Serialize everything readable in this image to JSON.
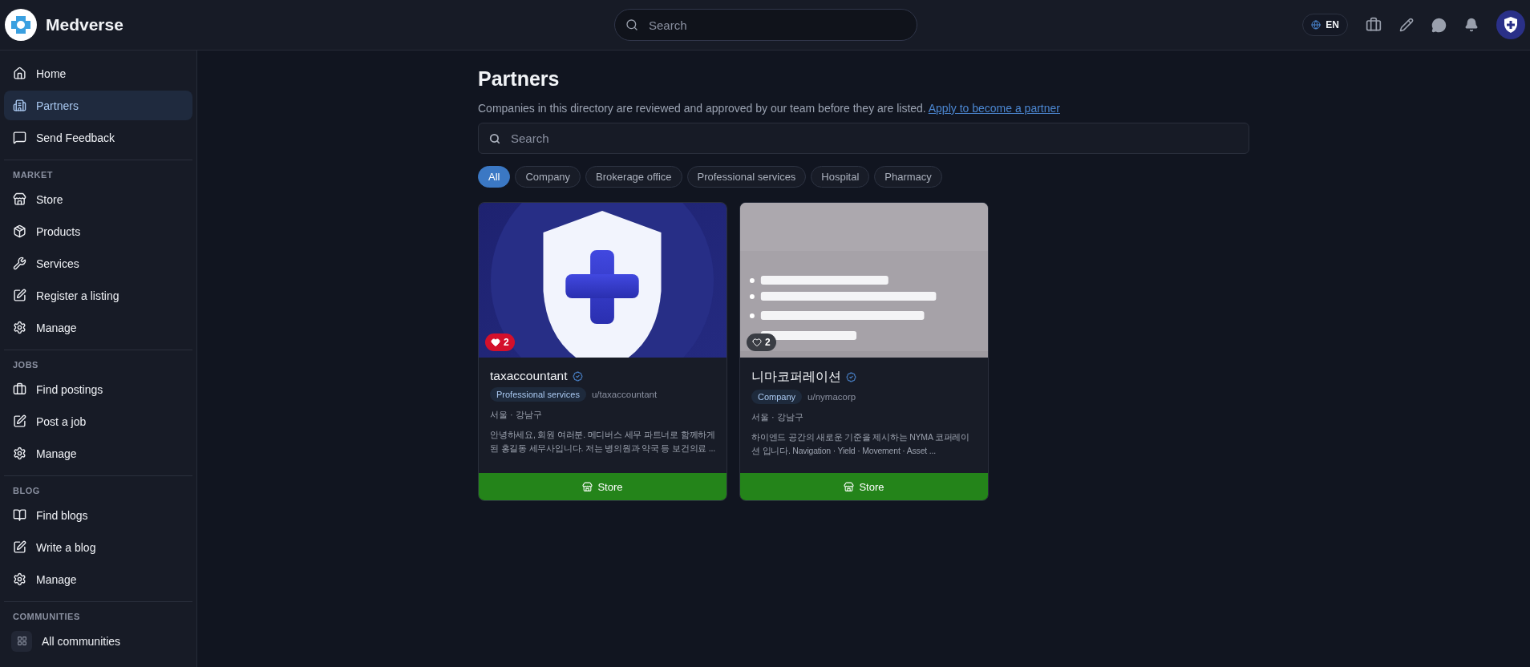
{
  "app": {
    "name": "Medverse"
  },
  "topbar": {
    "search": {
      "placeholder": "Search"
    },
    "language": "EN"
  },
  "sidebar": {
    "items": [
      {
        "label": "Home",
        "kind": "home",
        "selected": false
      },
      {
        "label": "Partners",
        "kind": "building",
        "selected": true
      },
      {
        "label": "Send Feedback",
        "kind": "message",
        "selected": false
      }
    ],
    "sections": [
      {
        "title": "MARKET",
        "items": [
          {
            "label": "Store",
            "kind": "store",
            "selected": false
          },
          {
            "label": "Products",
            "kind": "package",
            "selected": false
          },
          {
            "label": "Services",
            "kind": "wrench",
            "selected": false
          },
          {
            "label": "Register a listing",
            "kind": "edit",
            "selected": false
          },
          {
            "label": "Manage",
            "kind": "settings",
            "selected": false
          }
        ]
      },
      {
        "title": "JOBS",
        "items": [
          {
            "label": "Find postings",
            "kind": "briefcase",
            "selected": false
          },
          {
            "label": "Post a job",
            "kind": "edit",
            "selected": false
          },
          {
            "label": "Manage",
            "kind": "settings",
            "selected": false
          }
        ]
      },
      {
        "title": "BLOG",
        "items": [
          {
            "label": "Find blogs",
            "kind": "book",
            "selected": false
          },
          {
            "label": "Write a blog",
            "kind": "edit",
            "selected": false
          },
          {
            "label": "Manage",
            "kind": "settings",
            "selected": false
          }
        ]
      },
      {
        "title": "COMMUNITIES",
        "items": [
          {
            "label": "All communities",
            "kind": "grid",
            "selected": false
          }
        ]
      }
    ]
  },
  "page": {
    "title": "Partners",
    "description": "Companies in this directory are reviewed and approved by our team before they are listed.",
    "link": "Apply to become a partner",
    "search": {
      "placeholder": "Search"
    },
    "filters": [
      {
        "label": "All",
        "selected": true
      },
      {
        "label": "Company",
        "selected": false
      },
      {
        "label": "Brokerage office",
        "selected": false
      },
      {
        "label": "Professional services",
        "selected": false
      },
      {
        "label": "Hospital",
        "selected": false
      },
      {
        "label": "Pharmacy",
        "selected": false
      }
    ],
    "cards": [
      {
        "kind": "logo",
        "likes": "2",
        "liked": true,
        "name": "taxaccountant",
        "verified": true,
        "category": "Professional services",
        "handle": "u/taxaccountant",
        "location": "서울 · 강남구",
        "description": "안녕하세요, 회원 여러분. 메디버스 세무 파트너로 함께하게 된 홍길동 세무사입니다. 저는 병의원과 약국 등 보건의료 ...",
        "action": "Store"
      },
      {
        "kind": "picture",
        "likes": "2",
        "liked": false,
        "name": "니마코퍼레이션",
        "verified": true,
        "category": "Company",
        "handle": "u/nymacorp",
        "location": "서울 · 강남구",
        "description": "하이엔드 공간의 새로운 기준을 제시하는 NYMA 코퍼레이션 입니다. Navigation · Yield · Movement · Asset ...",
        "action": "Store"
      }
    ]
  }
}
